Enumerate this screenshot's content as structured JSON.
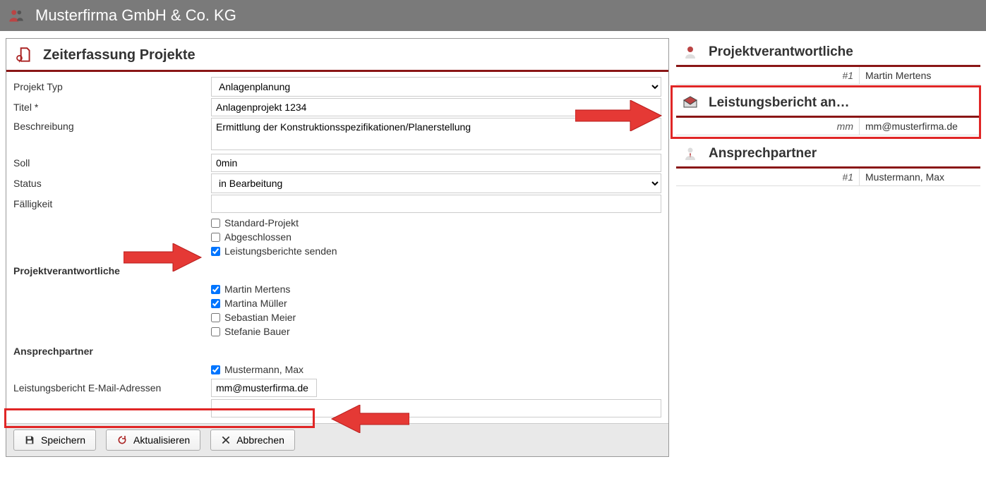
{
  "header": {
    "title": "Musterfirma GmbH & Co. KG"
  },
  "panel": {
    "title": "Zeiterfassung Projekte"
  },
  "form": {
    "projekt_typ_label": "Projekt Typ",
    "projekt_typ_value": "Anlagenplanung",
    "titel_label": "Titel *",
    "titel_value": "Anlagenprojekt 1234",
    "beschreibung_label": "Beschreibung",
    "beschreibung_value": "Ermittlung der Konstruktionsspezifikationen/Planerstellung",
    "soll_label": "Soll",
    "soll_value": "0min",
    "status_label": "Status",
    "status_value": "in Bearbeitung",
    "faelligkeit_label": "Fälligkeit",
    "faelligkeit_value": "",
    "checkbox_standard": "Standard-Projekt",
    "checkbox_abgeschlossen": "Abgeschlossen",
    "checkbox_leistung": "Leistungsberichte senden",
    "section_verantwortliche": "Projektverantwortliche",
    "verantwortliche": [
      "Martin Mertens",
      "Martina Müller",
      "Sebastian Meier",
      "Stefanie Bauer"
    ],
    "section_ansprechpartner": "Ansprechpartner",
    "ansprechpartner": [
      "Mustermann, Max"
    ],
    "email_label": "Leistungsbericht E-Mail-Adressen",
    "email_value": "mm@musterfirma.de"
  },
  "buttons": {
    "save": "Speichern",
    "refresh": "Aktualisieren",
    "cancel": "Abbrechen"
  },
  "right": {
    "verantwortliche_title": "Projektverantwortliche",
    "verantwortliche_num": "#1",
    "verantwortliche_name": "Martin Mertens",
    "leistung_title": "Leistungsbericht an…",
    "leistung_code": "mm",
    "leistung_email": "mm@musterfirma.de",
    "ansprech_title": "Ansprechpartner",
    "ansprech_num": "#1",
    "ansprech_name": "Mustermann, Max"
  }
}
